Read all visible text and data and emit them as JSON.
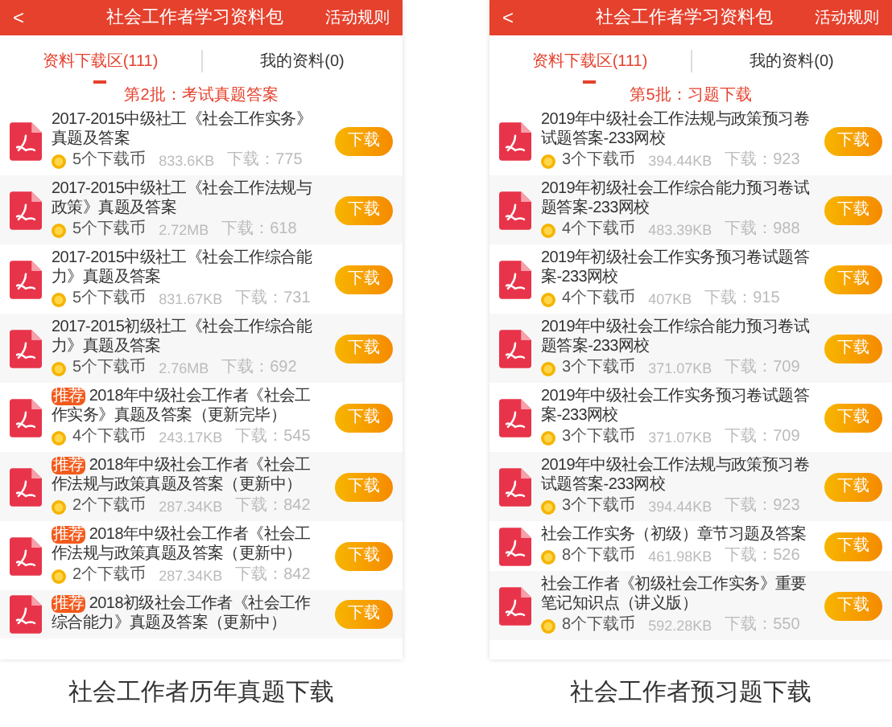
{
  "panels": [
    {
      "header": {
        "back": "<",
        "title": "社会工作者学习资料包",
        "rules": "活动规则"
      },
      "tabs": [
        {
          "label": "资料下载区(111)",
          "selected": true
        },
        {
          "label": "我的资料(0)",
          "selected": false
        }
      ],
      "batch": "第2批：考试真题答案",
      "items": [
        {
          "title": "2017-2015中级社工《社会工作实务》真题及答案",
          "recommended": false,
          "coins": "5个下载币",
          "size": "833.6KB",
          "downloads": "下载：775",
          "button": "下载"
        },
        {
          "title": "2017-2015中级社工《社会工作法规与政策》真题及答案",
          "recommended": false,
          "coins": "5个下载币",
          "size": "2.72MB",
          "downloads": "下载：618",
          "button": "下载"
        },
        {
          "title": "2017-2015中级社工《社会工作综合能力》真题及答案",
          "recommended": false,
          "coins": "5个下载币",
          "size": "831.67KB",
          "downloads": "下载：731",
          "button": "下载"
        },
        {
          "title": "2017-2015初级社工《社会工作综合能力》真题及答案",
          "recommended": false,
          "coins": "5个下载币",
          "size": "2.76MB",
          "downloads": "下载：692",
          "button": "下载"
        },
        {
          "title": "2018年中级社会工作者《社会工作实务》真题及答案（更新完毕）",
          "recommended": true,
          "tag": "推荐",
          "coins": "4个下载币",
          "size": "243.17KB",
          "downloads": "下载：545",
          "button": "下载"
        },
        {
          "title": "2018年中级社会工作者《社会工作法规与政策真题及答案（更新中）",
          "recommended": true,
          "tag": "推荐",
          "coins": "2个下载币",
          "size": "287.34KB",
          "downloads": "下载：842",
          "button": "下载"
        },
        {
          "title": "2018年中级社会工作者《社会工作法规与政策真题及答案（更新中）",
          "recommended": true,
          "tag": "推荐",
          "coins": "2个下载币",
          "size": "287.34KB",
          "downloads": "下载：842",
          "button": "下载"
        },
        {
          "title": "2018初级社会工作者《社会工作综合能力》真题及答案（更新中）",
          "recommended": true,
          "tag": "推荐",
          "button": "下载"
        }
      ],
      "caption": "社会工作者历年真题下载"
    },
    {
      "header": {
        "back": "<",
        "title": "社会工作者学习资料包",
        "rules": "活动规则"
      },
      "tabs": [
        {
          "label": "资料下载区(111)",
          "selected": true
        },
        {
          "label": "我的资料(0)",
          "selected": false
        }
      ],
      "batch": "第5批：习题下载",
      "items": [
        {
          "title": "2019年中级社会工作法规与政策预习卷试题答案-233网校",
          "recommended": false,
          "coins": "3个下载币",
          "size": "394.44KB",
          "downloads": "下载：923",
          "button": "下载"
        },
        {
          "title": "2019年初级社会工作综合能力预习卷试题答案-233网校",
          "recommended": false,
          "coins": "4个下载币",
          "size": "483.39KB",
          "downloads": "下载：988",
          "button": "下载"
        },
        {
          "title": "2019年初级社会工作实务预习卷试题答案-233网校",
          "recommended": false,
          "coins": "4个下载币",
          "size": "407KB",
          "downloads": "下载：915",
          "button": "下载"
        },
        {
          "title": "2019年中级社会工作综合能力预习卷试题答案-233网校",
          "recommended": false,
          "coins": "3个下载币",
          "size": "371.07KB",
          "downloads": "下载：709",
          "button": "下载"
        },
        {
          "title": "2019年中级社会工作实务预习卷试题答案-233网校",
          "recommended": false,
          "coins": "3个下载币",
          "size": "371.07KB",
          "downloads": "下载：709",
          "button": "下载"
        },
        {
          "title": "2019年中级社会工作法规与政策预习卷试题答案-233网校",
          "recommended": false,
          "coins": "3个下载币",
          "size": "394.44KB",
          "downloads": "下载：923",
          "button": "下载"
        },
        {
          "title": "社会工作实务（初级）章节习题及答案",
          "recommended": false,
          "coins": "8个下载币",
          "size": "461.98KB",
          "downloads": "下载：526",
          "button": "下载"
        },
        {
          "title": "社会工作者《初级社会工作实务》重要笔记知识点（讲义版）",
          "recommended": false,
          "coins": "8个下载币",
          "size": "592.28KB",
          "downloads": "下载：550",
          "button": "下载"
        }
      ],
      "caption": "社会工作者预习题下载"
    }
  ]
}
